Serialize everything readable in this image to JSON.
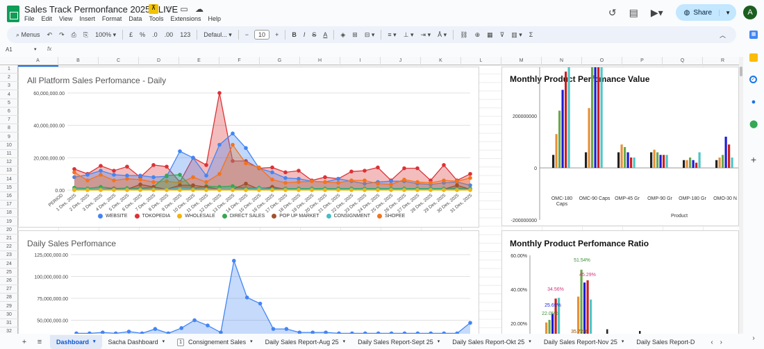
{
  "app": {
    "doc_title": "Sales Track Permonfance 2025 - LIVE",
    "menu": [
      "File",
      "Edit",
      "View",
      "Insert",
      "Format",
      "Data",
      "Tools",
      "Extensions",
      "Help"
    ],
    "share_label": "Share",
    "avatar_letter": "A"
  },
  "toolbar": {
    "menus_label": "Menus",
    "zoom": "100%",
    "currency": "£",
    "percent": "%",
    "decimals": ".0",
    "decimals_more": ".00",
    "number_format": "123",
    "font": "Defaul...",
    "font_size": "10",
    "minus": "−",
    "plus": "+"
  },
  "formula_bar": {
    "cell_ref": "A1",
    "fx": "fx"
  },
  "grid": {
    "columns": [
      "A",
      "B",
      "C",
      "D",
      "E",
      "F",
      "G",
      "H",
      "I",
      "J",
      "K",
      "L",
      "M",
      "N",
      "O",
      "P",
      "Q",
      "R"
    ],
    "rows": [
      "1",
      "2",
      "3",
      "4",
      "5",
      "6",
      "7",
      "8",
      "9",
      "10",
      "11",
      "12",
      "13",
      "14",
      "15",
      "16",
      "17",
      "18",
      "19",
      "20",
      "21",
      "22",
      "23",
      "24",
      "25",
      "26",
      "27",
      "28",
      "29",
      "30",
      "31",
      "32"
    ]
  },
  "chart1": {
    "title": "All Platform Sales Perfomance - Daily",
    "y_ticks": [
      "60,000,000.00",
      "40,000,000.00",
      "20,000,000.00",
      "0.00"
    ],
    "x_ticks": [
      "PERIOD",
      "1 Des, 2025",
      "2 Des, 2025",
      "3 Des, 2025",
      "4 Des, 2025",
      "5 Des, 2025",
      "6 Des, 2025",
      "7 Des, 2025",
      "8 Des, 2025",
      "9 Des, 2025",
      "10 Des, 2025",
      "11 Des, 2025",
      "12 Des, 2025",
      "13 Des, 2025",
      "14 Des, 2025",
      "15 Des, 2025",
      "16 Des, 2025",
      "17 Des, 2025",
      "18 Des, 2025",
      "19 Des, 2025",
      "20 Des, 2025",
      "21 Des, 2025",
      "22 Des, 2025",
      "23 Des, 2025",
      "24 Des, 2025",
      "25 Des, 2025",
      "26 Des, 2025",
      "27 Des, 2025",
      "28 Des, 2025",
      "29 Des, 2025",
      "30 Des, 2025",
      "31 Des, 2025"
    ],
    "legend": [
      {
        "name": "WEBSITE",
        "color": "#4285f4"
      },
      {
        "name": "TOKOPEDIA",
        "color": "#db3236"
      },
      {
        "name": "WHOLESALE",
        "color": "#f4b400"
      },
      {
        "name": "DIRECT SALES",
        "color": "#34a853"
      },
      {
        "name": "POP UP MARKET",
        "color": "#a0522d"
      },
      {
        "name": "CONSIGNMENT",
        "color": "#46bdc6"
      },
      {
        "name": "SHOPEE",
        "color": "#f4731c"
      }
    ]
  },
  "chart2": {
    "title": "Daily Sales Perfomance",
    "y_ticks": [
      "125,000,000.00",
      "100,000,000.00",
      "75,000,000.00",
      "50,000,000.00"
    ]
  },
  "chart3": {
    "title": "Monthly Product Perfomance Value",
    "y_ticks": [
      "600000000",
      "400000000",
      "200000000",
      "0",
      "-200000000"
    ],
    "categories": [
      "OMC-180 Caps",
      "OMC-90 Caps",
      "OMP-45 Gr",
      "OMP-90 Gr",
      "OMP-180 Gr",
      "OMO-30 N"
    ],
    "xlabel": "Product"
  },
  "chart4": {
    "title": "Monthly Product Perfomance Ratio",
    "y_ticks": [
      "60.00%",
      "40.00%",
      "20.00%"
    ],
    "data_labels": [
      "51.54%",
      "34.56%",
      "45.29%",
      "25.69%",
      "22.05%",
      "35.72%"
    ]
  },
  "chart_data": [
    {
      "type": "area",
      "title": "All Platform Sales Perfomance - Daily",
      "categories": [
        "1 Des",
        "2 Des",
        "3 Des",
        "4 Des",
        "5 Des",
        "6 Des",
        "7 Des",
        "8 Des",
        "9 Des",
        "10 Des",
        "11 Des",
        "12 Des",
        "13 Des",
        "14 Des",
        "15 Des",
        "16 Des",
        "17 Des",
        "18 Des",
        "19 Des",
        "20 Des",
        "21 Des",
        "22 Des",
        "23 Des",
        "24 Des",
        "25 Des",
        "26 Des",
        "27 Des",
        "28 Des",
        "29 Des",
        "30 Des",
        "31 Des"
      ],
      "ylim": [
        0,
        60000000
      ],
      "series": [
        {
          "name": "TOKOPEDIA",
          "values": [
            13000000,
            10000000,
            15000000,
            12000000,
            14500000,
            8000000,
            15500000,
            14500000,
            5000000,
            20000000,
            15500000,
            60000000,
            18000000,
            18000000,
            13500000,
            14000000,
            11000000,
            12000000,
            6000000,
            8000000,
            7000000,
            11500000,
            12000000,
            14000000,
            6000000,
            13500000,
            13500000,
            6000000,
            15500000,
            6000000,
            10000000
          ]
        },
        {
          "name": "WEBSITE",
          "values": [
            8000000,
            9500000,
            12000000,
            9500000,
            9000000,
            9000000,
            8000000,
            8500000,
            24000000,
            20000000,
            9000000,
            28000000,
            35000000,
            26000000,
            13500000,
            11000000,
            7500000,
            7000000,
            5500000,
            5000000,
            7000000,
            5500000,
            4000000,
            5000000,
            5500000,
            5500000,
            4000000,
            3500000,
            4500000,
            5000000,
            3000000
          ]
        },
        {
          "name": "SHOPEE",
          "values": [
            11000000,
            6000000,
            9500000,
            6000000,
            7000000,
            6500000,
            5000000,
            5500000,
            4500000,
            8000000,
            5000000,
            10000000,
            28000000,
            16500000,
            14000000,
            6500000,
            4500000,
            5000000,
            5500000,
            5000000,
            4500000,
            6000000,
            6000000,
            4000000,
            3500000,
            6500000,
            5000000,
            4500000,
            6000000,
            5500000,
            7500000
          ]
        },
        {
          "name": "DIRECT SALES",
          "values": [
            1500000,
            1000000,
            2000000,
            1000000,
            1200000,
            1000000,
            2000000,
            9000000,
            9500000,
            1000000,
            2500000,
            2000000,
            2500000,
            1000000,
            1500000,
            1000000,
            1000000,
            1000000,
            1000000,
            1000000,
            1000000,
            1000000,
            1000000,
            1000000,
            1000000,
            1000000,
            1000000,
            1000000,
            1000000,
            1000000,
            1000000
          ]
        },
        {
          "name": "POP UP MARKET",
          "values": [
            500000,
            500000,
            500000,
            1000000,
            500000,
            3500000,
            2000000,
            500000,
            3000000,
            3000000,
            2000000,
            500000,
            500000,
            4000000,
            500000,
            2000000,
            500000,
            500000,
            500000,
            500000,
            500000,
            500000,
            500000,
            500000,
            500000,
            500000,
            500000,
            500000,
            500000,
            3000000,
            500000
          ]
        },
        {
          "name": "CONSIGNMENT",
          "values": [
            500000,
            500000,
            500000,
            500000,
            500000,
            500000,
            500000,
            500000,
            1000000,
            500000,
            500000,
            500000,
            500000,
            500000,
            1000000,
            500000,
            500000,
            500000,
            500000,
            500000,
            500000,
            500000,
            500000,
            500000,
            500000,
            500000,
            500000,
            500000,
            500000,
            500000,
            500000
          ]
        },
        {
          "name": "WHOLESALE",
          "values": [
            0,
            0,
            0,
            0,
            0,
            0,
            0,
            0,
            0,
            0,
            0,
            0,
            0,
            0,
            0,
            0,
            0,
            0,
            0,
            0,
            0,
            0,
            0,
            0,
            0,
            0,
            0,
            0,
            0,
            0,
            0
          ]
        }
      ]
    },
    {
      "type": "area",
      "title": "Daily Sales Perfomance",
      "ylim": [
        30000000,
        130000000
      ],
      "values": [
        35000000,
        35000000,
        36000000,
        35000000,
        37000000,
        35000000,
        40000000,
        35000000,
        41000000,
        50000000,
        44000000,
        36000000,
        118000000,
        76000000,
        69000000,
        40000000,
        40000000,
        36000000,
        36000000,
        36000000,
        35000000,
        35000000,
        35000000,
        35000000,
        35000000,
        35000000,
        35000000,
        35000000,
        35000000,
        35000000,
        47000000
      ]
    },
    {
      "type": "bar",
      "title": "Monthly Product Perfomance Value",
      "categories": [
        "OMC-180 Caps",
        "OMC-90 Caps",
        "OMP-45 Gr",
        "OMP-90 Gr",
        "OMP-180 Gr",
        "OMO-30 N"
      ],
      "ylim": [
        -200000000,
        600000000
      ],
      "series": [
        {
          "color": "#222222",
          "values": [
            50000000,
            60000000,
            60000000,
            60000000,
            30000000,
            30000000
          ]
        },
        {
          "color": "#e69138",
          "values": [
            130000000,
            230000000,
            90000000,
            70000000,
            30000000,
            40000000
          ]
        },
        {
          "color": "#6aa84f",
          "values": [
            220000000,
            530000000,
            80000000,
            60000000,
            40000000,
            50000000
          ]
        },
        {
          "color": "#1c1cd6",
          "values": [
            300000000,
            490000000,
            60000000,
            50000000,
            30000000,
            120000000
          ]
        },
        {
          "color": "#cc1f1f",
          "values": [
            370000000,
            470000000,
            40000000,
            50000000,
            20000000,
            90000000
          ]
        },
        {
          "color": "#4fc6c6",
          "values": [
            410000000,
            450000000,
            40000000,
            50000000,
            60000000,
            40000000
          ]
        }
      ],
      "xlabel": "Product"
    },
    {
      "type": "bar",
      "title": "Monthly Product Perfomance Ratio",
      "ylim": [
        15,
        62
      ],
      "series": [
        {
          "color": "#e69138",
          "values": [
            20.5,
            35.72
          ]
        },
        {
          "color": "#6aa84f",
          "values": [
            22.05,
            51.54
          ]
        },
        {
          "color": "#1c1cd6",
          "values": [
            25.69,
            44.0
          ]
        },
        {
          "color": "#cc1f1f",
          "values": [
            34.56,
            45.29
          ]
        },
        {
          "color": "#4fc6c6",
          "values": [
            35.0,
            34.0
          ]
        }
      ]
    }
  ],
  "tabs": [
    {
      "label": "Dashboard",
      "active": true
    },
    {
      "label": "Sacha Dashboard",
      "active": false
    },
    {
      "label": "Consignement Sales",
      "active": false,
      "badge": "1"
    },
    {
      "label": "Daily Sales Report-Aug 25",
      "active": false
    },
    {
      "label": "Daily Sales Report-Sept 25",
      "active": false
    },
    {
      "label": "Daily Sales Report-Okt 25",
      "active": false
    },
    {
      "label": "Daily Sales Report-Nov 25",
      "active": false
    },
    {
      "label": "Daily Sales Report-D",
      "active": false
    }
  ]
}
